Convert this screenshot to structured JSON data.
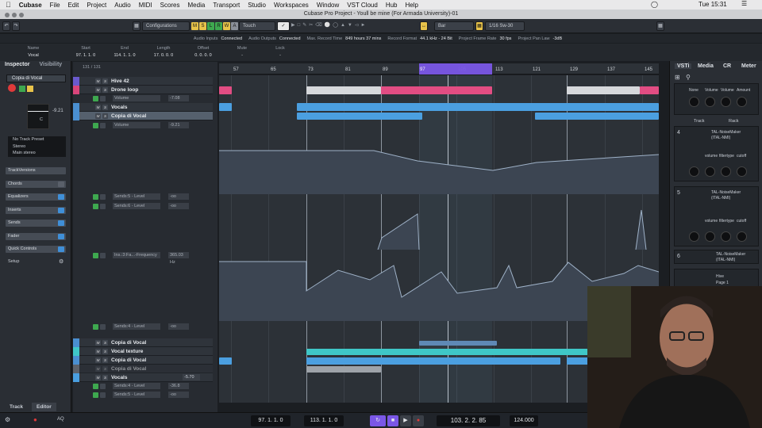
{
  "menubar": {
    "app": "Cubase",
    "items": [
      "File",
      "Edit",
      "Project",
      "Audio",
      "MIDI",
      "Scores",
      "Media",
      "Transport",
      "Studio",
      "Workspaces",
      "Window",
      "VST Cloud",
      "Hub",
      "Help"
    ],
    "clock": "Tue 15:31"
  },
  "window": {
    "title": "Cubase Pro Project - Youll be mine (For Armada University)-01"
  },
  "toolbar": {
    "configurations": "Configurations",
    "automation_mode": "Touch",
    "modes": [
      "M",
      "S",
      "L",
      "R",
      "W",
      "A"
    ],
    "grid_type": "Bar",
    "quantize": "1/16 Sw-30"
  },
  "status": {
    "items": [
      {
        "label": "Audio Inputs",
        "value": "Connected"
      },
      {
        "label": "Audio Outputs",
        "value": "Connected"
      },
      {
        "label": "Max. Record Time",
        "value": "849 hours 37 mins"
      },
      {
        "label": "Record Format",
        "value": "44.1 kHz - 24 Bit"
      },
      {
        "label": "Project Frame Rate",
        "value": "30 fps"
      },
      {
        "label": "Project Pan Law",
        "value": "-3dB"
      }
    ]
  },
  "infoline": {
    "fields": [
      {
        "label": "Name",
        "value": "Vocal"
      },
      {
        "label": "Start",
        "value": "97. 1. 1. 0"
      },
      {
        "label": "End",
        "value": "114. 1. 1. 0"
      },
      {
        "label": "Length",
        "value": "17. 0. 0. 0"
      },
      {
        "label": "Offset",
        "value": "0. 0. 0. 0"
      },
      {
        "label": "Mute",
        "value": "-"
      },
      {
        "label": "Lock",
        "value": "-"
      }
    ]
  },
  "inspector": {
    "tabs": [
      "Inspector",
      "Visibility"
    ],
    "track_name": "Copia di Vocal",
    "volume": "-9.21",
    "pan": "C",
    "no_track_preset": "No Track Preset",
    "input": "Stereo",
    "output": "Main stereo",
    "sections": [
      "TrackVersions",
      "Chords",
      "Equalizers",
      "Inserts",
      "Sends",
      "Fader",
      "Quick Controls",
      "Setup"
    ],
    "bottom_tabs": [
      "Track",
      "Editor"
    ]
  },
  "tracks": {
    "counter": "131 / 131",
    "rows": [
      {
        "name": "Hive 42",
        "color": "#6a5acd"
      },
      {
        "name": "Drone loop",
        "color": "#d9457a"
      },
      {
        "name": "Vocals",
        "color": "#4a8fd0"
      },
      {
        "name": "Copia di Vocal",
        "color": "#4a8fd0"
      }
    ],
    "lanes": [
      {
        "label": "Volume",
        "value": "-7.08"
      },
      {
        "label": "Volume",
        "value": "-9.21"
      },
      {
        "label": "Sends:5 - Level",
        "value": "-oo"
      },
      {
        "label": "Sends:6 - Level",
        "value": "-oo"
      },
      {
        "label": "Ins.:3:Fa...-Frequency",
        "value": "365.03 Hz"
      },
      {
        "label": "Sends:4 - Level",
        "value": "-oo"
      }
    ],
    "bottom_rows": [
      {
        "name": "Copia di Vocal"
      },
      {
        "name": "Vocal texture"
      },
      {
        "name": "Copia di Vocal"
      },
      {
        "name": "Copia di Vocal"
      },
      {
        "name": "Vocals",
        "value": "-5.70"
      }
    ],
    "bottom_lanes": [
      {
        "label": "Sends:4 - Level",
        "value": "-36.8"
      },
      {
        "label": "Sends:5 - Level",
        "value": "-oo"
      }
    ]
  },
  "ruler": {
    "bars": [
      "57",
      "65",
      "73",
      "81",
      "89",
      "97",
      "105",
      "113",
      "121",
      "129",
      "137",
      "145"
    ]
  },
  "right_zone": {
    "tabs": [
      "VSTi",
      "Media",
      "CR",
      "Meter"
    ],
    "track_label": "Track",
    "rack_label": "Rack",
    "slot_top": {
      "knob_labels": [
        "None",
        "Volume",
        "Volume",
        "Amount"
      ]
    },
    "slots": [
      {
        "num": "4",
        "name": "TAL-NoiseMaker",
        "sub": "(ITAL-NMI)",
        "knobs": [
          "volume",
          "filtertype",
          "cutoff"
        ]
      },
      {
        "num": "5",
        "name": "TAL-NoiseMaker",
        "sub": "(ITAL-NMI)",
        "knobs": [
          "volume",
          "filtertype",
          "cutoff"
        ]
      },
      {
        "num": "6",
        "name": "TAL-NoiseMaker",
        "sub": "(ITAL-NMI)"
      },
      {
        "name": "Hive",
        "sub": "Page 1"
      }
    ]
  },
  "transport": {
    "left_locator": "97. 1. 1. 0",
    "right_locator": "113. 1. 1. 0",
    "position": "103. 2. 2. 85",
    "tempo": "124.000"
  },
  "colors": {
    "loop": "#7a57e6",
    "pink": "#e24d83",
    "blue": "#4b9fe0",
    "teal": "#3fc7c7",
    "record": "#e03a3a",
    "green": "#3ea84f"
  }
}
